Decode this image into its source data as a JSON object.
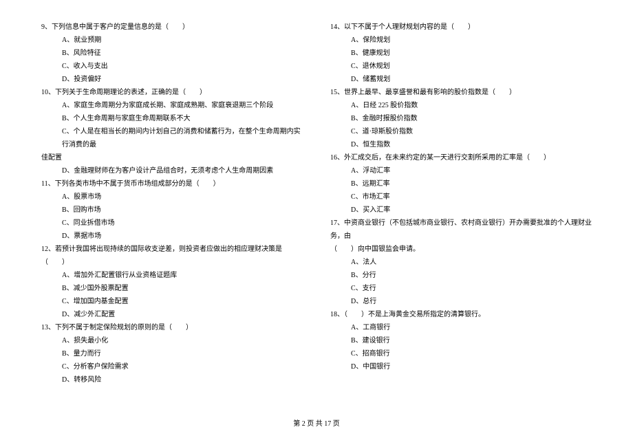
{
  "footer": "第 2 页 共 17 页",
  "left": {
    "q9": {
      "stem": "9、下列信息中属于客户的定量信息的是（　　）",
      "a": "A、就业预期",
      "b": "B、风险特征",
      "c": "C、收入与支出",
      "d": "D、投资偏好"
    },
    "q10": {
      "stem": "10、下列关于生命周期理论的表述，正确的是（　　）",
      "a": "A、家庭生命周期分为家庭成长期、家庭成熟期、家庭衰退期三个阶段",
      "b": "B、个人生命周期与家庭生命周期联系不大",
      "c": "C、个人是在相当长的期间内计划自己的消费和储蓄行为，在整个生命周期内实行消费的最",
      "c_cont": "佳配置",
      "d": "D、金融理财师在为客户设计产品组合时，无须考虑个人生命周期因素"
    },
    "q11": {
      "stem": "11、下列各类市场中不属于货币市场组成部分的是（　　）",
      "a": "A、股票市场",
      "b": "B、回购市场",
      "c": "C、同业拆借市场",
      "d": "D、票据市场"
    },
    "q12": {
      "stem": "12、若预计我国将出现持续的国际收支逆差，则投资者应做出的相应理财决策是（　　）",
      "a": "A、增加外汇配置银行从业资格证题库",
      "b": "B、减少国外股票配置",
      "c": "C、增加国内基金配置",
      "d": "D、减少外汇配置"
    },
    "q13": {
      "stem": "13、下列不属于制定保险规划的原则的是（　　）",
      "a": "A、损失最小化",
      "b": "B、量力而行",
      "c": "C、分析客户保险需求",
      "d": "D、转移风险"
    }
  },
  "right": {
    "q14": {
      "stem": "14、以下不属于个人理财规划内容的是（　　）",
      "a": "A、保险规划",
      "b": "B、健康规划",
      "c": "C、退休规划",
      "d": "D、储蓄规划"
    },
    "q15": {
      "stem": "15、世界上最早、最享盛誉和最有影响的股价指数是（　　）",
      "a": "A、日经 225 股价指数",
      "b": "B、金融时报股价指数",
      "c": "C、道·琼斯股价指数",
      "d": "D、恒生指数"
    },
    "q16": {
      "stem": "16、外汇成交后，在未来约定的某一天进行交割所采用的汇率是（　　）",
      "a": "A、浮动汇率",
      "b": "B、远期汇率",
      "c": "C、市场汇率",
      "d": "D、买入汇率"
    },
    "q17": {
      "stem": "17、中资商业银行（不包括城市商业银行、农村商业银行）开办需要批准的个人理财业务，由",
      "stem_cont": "（　　）向中国银监会申请。",
      "a": "A、法人",
      "b": "B、分行",
      "c": "C、支行",
      "d": "D、总行"
    },
    "q18": {
      "stem": "18、（　　）不是上海黄金交易所指定的清算银行。",
      "a": "A、工商银行",
      "b": "B、建设银行",
      "c": "C、招商银行",
      "d": "D、中国银行"
    }
  }
}
